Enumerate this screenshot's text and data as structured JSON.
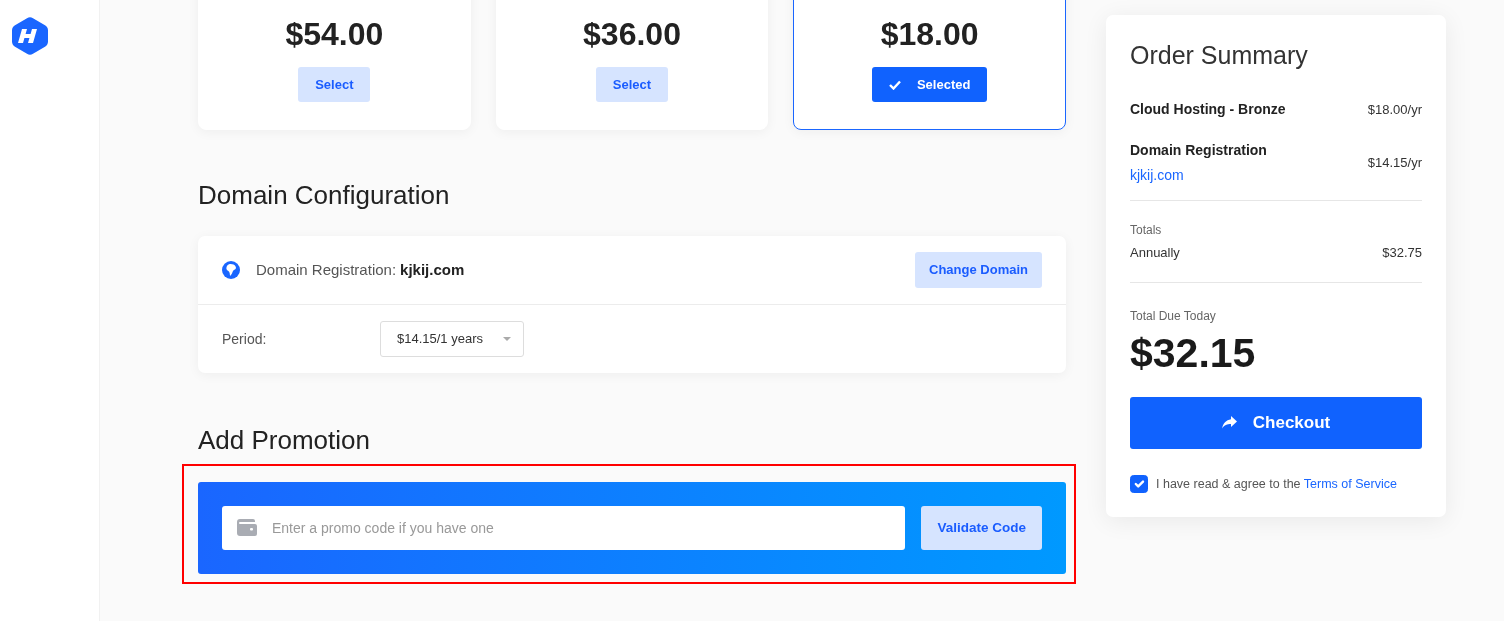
{
  "plans": [
    {
      "price": "$54.00",
      "button": "Select",
      "selected": false
    },
    {
      "price": "$36.00",
      "button": "Select",
      "selected": false
    },
    {
      "price": "$18.00",
      "button": "Selected",
      "selected": true
    }
  ],
  "domain_configuration": {
    "heading": "Domain Configuration",
    "label": "Domain Registration:",
    "domain": "kjkij.com",
    "button": "Change Domain",
    "period_label": "Period:",
    "period_value": "$14.15/1 years"
  },
  "promotion": {
    "heading": "Add Promotion",
    "placeholder": "Enter a promo code if you have one",
    "button": "Validate Code",
    "highlighted": true
  },
  "order_summary": {
    "title": "Order Summary",
    "items": [
      {
        "name": "Cloud Hosting - Bronze",
        "price": "$18.00/yr"
      },
      {
        "name": "Domain Registration",
        "detail": "kjkij.com",
        "price": "$14.15/yr"
      }
    ],
    "totals_label": "Totals",
    "totals": [
      {
        "label": "Annually",
        "amount": "$32.75"
      }
    ],
    "due_label": "Total Due Today",
    "due_amount": "$32.15",
    "checkout_button": "Checkout",
    "agreement": {
      "text": "I have read & agree to the",
      "link": "Terms of Service",
      "checked": true
    }
  }
}
